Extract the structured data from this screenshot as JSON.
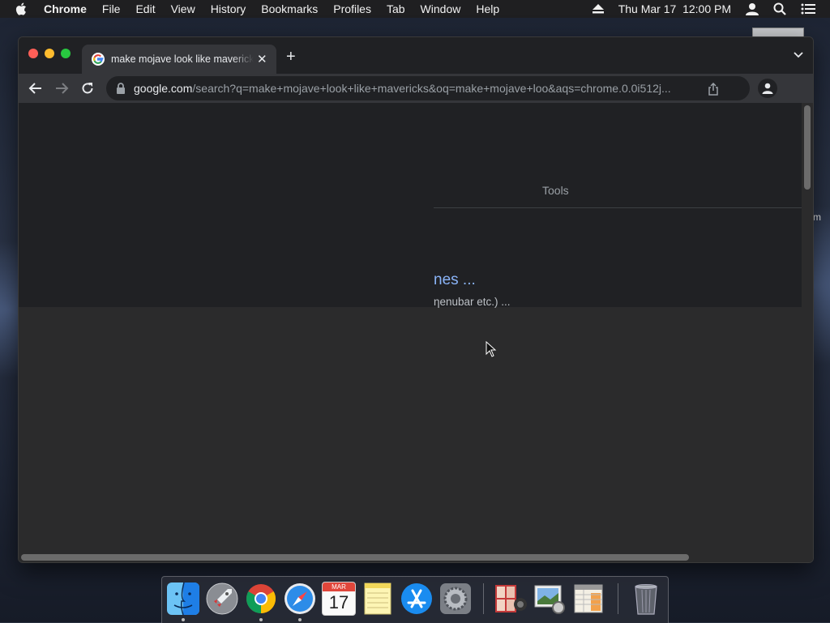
{
  "menubar": {
    "app_name": "Chrome",
    "items": [
      "File",
      "Edit",
      "View",
      "History",
      "Bookmarks",
      "Profiles",
      "Tab",
      "Window",
      "Help"
    ],
    "clock": "Thu Mar 17  12:00 PM"
  },
  "desktop": {
    "partial_label": "m"
  },
  "browser": {
    "tab": {
      "title": "make mojave look like mavericks - Google Search",
      "close_glyph": "✕"
    },
    "new_tab_glyph": "+",
    "address": {
      "host": "google.com",
      "path": "/search?q=make+mojave+look+like+mavericks&oq=make+mojave+loo&aqs=chrome.0.0i512j..."
    },
    "page": {
      "tools_label": "Tools",
      "result_title_fragment": "nes ...",
      "result_snippet_fragment": "ηenubar etc.) ..."
    }
  },
  "dock": {
    "apps": [
      "Finder",
      "Launchpad",
      "Google Chrome",
      "Safari",
      "Calendar",
      "Notes",
      "App Store",
      "System Preferences",
      "Photo Booth",
      "Preview",
      "Numbers",
      "Trash"
    ],
    "calendar": {
      "month": "MAR",
      "day": "17"
    }
  }
}
